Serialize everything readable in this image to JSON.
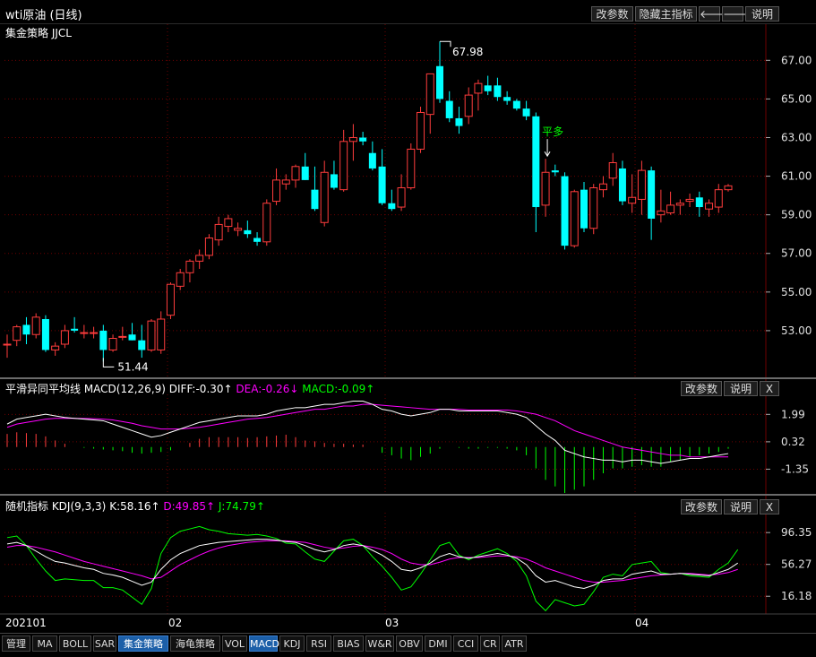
{
  "window": {
    "title": "wti原油 (日线)",
    "indicator_name": "集金策略 JJCL"
  },
  "main_buttons": {
    "params": "改参数",
    "hide": "隐藏主指标",
    "left": "🡐",
    "right": "🡒",
    "help": "说明"
  },
  "macd_panel": {
    "name": "平滑异同平均线 MACD(12,26,9)",
    "diff": "DIFF:-0.30↑",
    "dea": "DEA:-0.26↓",
    "macd": "MACD:-0.09↑",
    "params": "改参数",
    "help": "说明",
    "close": "X"
  },
  "kdj_panel": {
    "name": "随机指标 KDJ(9,3,3)",
    "k": "K:58.16↑",
    "d": "D:49.85↑",
    "j": "J:74.79↑",
    "params": "改参数",
    "help": "说明",
    "close": "X"
  },
  "x_axis": {
    "labels": [
      "202101",
      "02",
      "03",
      "04"
    ]
  },
  "annotations": {
    "high": "67.98",
    "low": "51.44",
    "signal": "平多"
  },
  "tabs": [
    "管理",
    "MA",
    "BOLL",
    "SAR",
    "集金策略",
    "海龟策略",
    "VOL",
    "MACD",
    "KDJ",
    "RSI",
    "BIAS",
    "W&R",
    "OBV",
    "DMI",
    "CCI",
    "CR",
    "ATR"
  ],
  "active_tabs": [
    "集金策略",
    "MACD"
  ],
  "colors": {
    "up": "#ff3c3c",
    "down": "#00ffff",
    "dea": "#ff00ff",
    "green": "#00ff00",
    "grid": "#6e0000"
  },
  "chart_data": [
    {
      "type": "candlestick",
      "title": "wti原油 (日线)",
      "y_ticks": [
        53.0,
        55.0,
        57.0,
        59.0,
        61.0,
        63.0,
        65.0,
        67.0
      ],
      "ylim": [
        51.0,
        68.5
      ],
      "high_label": 67.98,
      "low_label": 51.44,
      "ohlc": [
        [
          52.3,
          52.8,
          51.6,
          52.3
        ],
        [
          52.5,
          53.3,
          52.2,
          53.2
        ],
        [
          53.3,
          53.7,
          52.3,
          52.8
        ],
        [
          52.8,
          53.9,
          52.6,
          53.7
        ],
        [
          53.6,
          53.8,
          51.9,
          52.0
        ],
        [
          52.0,
          52.4,
          51.7,
          52.2
        ],
        [
          52.3,
          53.3,
          52.1,
          53.0
        ],
        [
          53.1,
          53.7,
          52.9,
          53.0
        ],
        [
          52.9,
          53.3,
          52.6,
          52.9
        ],
        [
          52.9,
          53.2,
          52.6,
          52.9
        ],
        [
          53.0,
          53.3,
          51.4,
          52.0
        ],
        [
          52.0,
          52.8,
          51.9,
          52.6
        ],
        [
          52.7,
          53.2,
          52.5,
          52.7
        ],
        [
          52.8,
          53.4,
          52.5,
          52.5
        ],
        [
          52.5,
          53.3,
          51.6,
          52.0
        ],
        [
          52.0,
          53.6,
          51.9,
          53.5
        ],
        [
          52.0,
          54.0,
          51.8,
          53.6
        ],
        [
          53.8,
          55.5,
          53.6,
          55.4
        ],
        [
          55.3,
          56.2,
          55.1,
          56.0
        ],
        [
          56.0,
          56.7,
          55.5,
          56.6
        ],
        [
          56.6,
          57.2,
          56.2,
          56.9
        ],
        [
          56.9,
          58.0,
          56.7,
          57.8
        ],
        [
          57.7,
          58.9,
          57.4,
          58.5
        ],
        [
          58.4,
          59.0,
          58.1,
          58.8
        ],
        [
          58.2,
          58.6,
          57.9,
          58.3
        ],
        [
          58.2,
          58.7,
          57.8,
          58.0
        ],
        [
          57.8,
          58.1,
          57.4,
          57.6
        ],
        [
          57.6,
          59.8,
          57.4,
          59.6
        ],
        [
          59.7,
          61.4,
          59.5,
          60.8
        ],
        [
          60.6,
          61.1,
          60.3,
          60.8
        ],
        [
          60.8,
          61.6,
          60.4,
          61.5
        ],
        [
          61.5,
          62.2,
          60.8,
          60.8
        ],
        [
          60.3,
          61.5,
          59.2,
          59.3
        ],
        [
          58.6,
          61.8,
          58.4,
          61.2
        ],
        [
          61.1,
          61.8,
          60.3,
          60.4
        ],
        [
          60.3,
          63.4,
          60.2,
          62.8
        ],
        [
          62.8,
          63.7,
          61.8,
          63.0
        ],
        [
          63.0,
          63.3,
          62.6,
          62.8
        ],
        [
          62.2,
          62.8,
          61.3,
          61.4
        ],
        [
          61.5,
          62.4,
          59.5,
          59.6
        ],
        [
          59.6,
          60.3,
          59.2,
          59.3
        ],
        [
          59.4,
          61.1,
          59.2,
          60.4
        ],
        [
          60.4,
          62.7,
          60.3,
          62.4
        ],
        [
          62.4,
          64.6,
          62.2,
          64.3
        ],
        [
          64.2,
          66.3,
          63.2,
          66.3
        ],
        [
          66.7,
          67.98,
          64.8,
          65.0
        ],
        [
          64.9,
          65.4,
          63.8,
          64.0
        ],
        [
          64.0,
          64.6,
          63.2,
          63.6
        ],
        [
          64.1,
          65.6,
          63.7,
          65.2
        ],
        [
          65.3,
          66.0,
          64.4,
          65.8
        ],
        [
          65.7,
          66.2,
          65.2,
          65.4
        ],
        [
          65.7,
          66.1,
          64.9,
          65.1
        ],
        [
          65.1,
          65.4,
          64.7,
          64.9
        ],
        [
          64.9,
          65.0,
          64.4,
          64.5
        ],
        [
          64.5,
          64.9,
          63.9,
          64.1
        ],
        [
          64.1,
          64.3,
          58.1,
          59.4
        ],
        [
          59.5,
          61.9,
          58.9,
          61.2
        ],
        [
          61.3,
          61.6,
          61.0,
          61.2
        ],
        [
          61.0,
          61.2,
          57.2,
          57.4
        ],
        [
          57.4,
          60.3,
          57.3,
          60.2
        ],
        [
          60.3,
          60.7,
          58.1,
          58.3
        ],
        [
          58.3,
          60.6,
          58.0,
          60.4
        ],
        [
          60.3,
          61.0,
          59.9,
          60.6
        ],
        [
          60.9,
          62.2,
          60.5,
          61.7
        ],
        [
          61.4,
          61.8,
          59.5,
          59.7
        ],
        [
          59.6,
          61.1,
          59.1,
          59.9
        ],
        [
          59.8,
          61.8,
          59.0,
          61.3
        ],
        [
          61.3,
          61.5,
          57.7,
          58.8
        ],
        [
          59.0,
          60.3,
          58.6,
          59.2
        ],
        [
          59.1,
          60.2,
          59.0,
          59.5
        ],
        [
          59.5,
          59.8,
          59.0,
          59.6
        ],
        [
          59.7,
          60.1,
          59.4,
          59.8
        ],
        [
          59.9,
          60.2,
          58.9,
          59.4
        ],
        [
          59.3,
          59.8,
          58.9,
          59.6
        ],
        [
          59.4,
          60.6,
          59.1,
          60.3
        ],
        [
          60.3,
          60.6,
          60.2,
          60.5
        ]
      ]
    },
    {
      "type": "line",
      "title": "平滑异同平均线 MACD(12,26,9)",
      "y_ticks": [
        1.99,
        0.32,
        -1.35
      ],
      "ylim": [
        -2.8,
        3.1
      ],
      "series": [
        {
          "name": "DIFF",
          "values": [
            1.4,
            1.7,
            1.8,
            1.9,
            2.0,
            1.9,
            1.8,
            1.75,
            1.7,
            1.65,
            1.6,
            1.4,
            1.2,
            1.0,
            0.8,
            0.6,
            0.7,
            0.9,
            1.1,
            1.3,
            1.5,
            1.6,
            1.7,
            1.8,
            1.9,
            1.9,
            1.9,
            2.0,
            2.2,
            2.3,
            2.4,
            2.4,
            2.5,
            2.6,
            2.6,
            2.7,
            2.8,
            2.8,
            2.6,
            2.3,
            2.2,
            2.0,
            1.9,
            2.0,
            2.1,
            2.3,
            2.3,
            2.2,
            2.2,
            2.2,
            2.2,
            2.2,
            2.1,
            2.0,
            1.8,
            1.3,
            0.8,
            0.4,
            -0.2,
            -0.4,
            -0.6,
            -0.7,
            -0.8,
            -0.8,
            -0.9,
            -0.8,
            -0.8,
            -0.9,
            -1.0,
            -0.9,
            -0.8,
            -0.7,
            -0.7,
            -0.6,
            -0.5,
            -0.4
          ]
        },
        {
          "name": "DEA",
          "values": [
            1.2,
            1.4,
            1.5,
            1.6,
            1.7,
            1.75,
            1.75,
            1.75,
            1.74,
            1.73,
            1.7,
            1.65,
            1.55,
            1.45,
            1.3,
            1.2,
            1.1,
            1.1,
            1.1,
            1.15,
            1.2,
            1.3,
            1.4,
            1.5,
            1.6,
            1.7,
            1.75,
            1.8,
            1.9,
            2.0,
            2.1,
            2.2,
            2.3,
            2.3,
            2.4,
            2.5,
            2.5,
            2.6,
            2.6,
            2.55,
            2.5,
            2.45,
            2.4,
            2.35,
            2.3,
            2.3,
            2.3,
            2.3,
            2.25,
            2.25,
            2.25,
            2.25,
            2.25,
            2.2,
            2.1,
            2.0,
            1.8,
            1.6,
            1.3,
            1.0,
            0.8,
            0.6,
            0.4,
            0.2,
            0.0,
            -0.1,
            -0.2,
            -0.3,
            -0.4,
            -0.5,
            -0.5,
            -0.6,
            -0.6,
            -0.6,
            -0.6,
            -0.6
          ]
        },
        {
          "name": "MACD",
          "values": [
            0.8,
            0.9,
            0.85,
            0.8,
            0.65,
            0.4,
            0.2,
            0.0,
            -0.05,
            -0.1,
            -0.15,
            -0.2,
            -0.25,
            -0.35,
            -0.4,
            -0.35,
            -0.3,
            -0.2,
            0.0,
            0.25,
            0.5,
            0.6,
            0.6,
            0.6,
            0.6,
            0.55,
            0.6,
            0.65,
            0.7,
            0.75,
            0.6,
            0.4,
            0.35,
            0.25,
            0.2,
            0.2,
            0.15,
            0.15,
            0.0,
            -0.35,
            -0.5,
            -0.7,
            -0.8,
            -0.6,
            -0.4,
            -0.1,
            0.0,
            -0.05,
            -0.1,
            -0.1,
            -0.05,
            -0.05,
            -0.1,
            -0.2,
            -0.5,
            -1.3,
            -2.0,
            -2.4,
            -2.8,
            -2.6,
            -2.4,
            -2.0,
            -1.6,
            -1.3,
            -1.3,
            -1.2,
            -1.1,
            -1.2,
            -1.2,
            -0.9,
            -0.8,
            -0.6,
            -0.5,
            -0.4,
            -0.3,
            -0.1
          ]
        }
      ]
    },
    {
      "type": "line",
      "title": "随机指标 KDJ(9,3,3)",
      "y_ticks": [
        96.35,
        56.27,
        16.18
      ],
      "ylim": [
        -5,
        118
      ],
      "series": [
        {
          "name": "K",
          "values": [
            82,
            84,
            80,
            73,
            66,
            60,
            58,
            55,
            52,
            50,
            45,
            43,
            40,
            35,
            30,
            34,
            50,
            62,
            70,
            75,
            80,
            82,
            84,
            85,
            86,
            87,
            88,
            88,
            87,
            85,
            84,
            80,
            75,
            72,
            75,
            80,
            82,
            80,
            74,
            68,
            60,
            50,
            48,
            52,
            58,
            66,
            70,
            66,
            64,
            66,
            68,
            70,
            68,
            64,
            56,
            42,
            34,
            36,
            32,
            28,
            26,
            30,
            36,
            38,
            38,
            44,
            46,
            48,
            44,
            44,
            45,
            44,
            43,
            42,
            46,
            50,
            58
          ]
        },
        {
          "name": "D",
          "values": [
            78,
            80,
            80,
            78,
            75,
            72,
            68,
            64,
            60,
            57,
            54,
            51,
            48,
            45,
            42,
            38,
            40,
            48,
            56,
            62,
            68,
            73,
            77,
            80,
            82,
            84,
            85,
            86,
            86,
            86,
            85,
            84,
            81,
            78,
            76,
            77,
            79,
            80,
            78,
            75,
            70,
            63,
            58,
            56,
            56,
            59,
            63,
            65,
            65,
            65,
            66,
            67,
            67,
            66,
            63,
            58,
            52,
            48,
            44,
            40,
            36,
            34,
            34,
            35,
            36,
            38,
            40,
            42,
            43,
            44,
            45,
            45,
            44,
            43,
            44,
            46,
            50
          ]
        },
        {
          "name": "J",
          "values": [
            90,
            92,
            80,
            63,
            48,
            36,
            38,
            37,
            36,
            36,
            27,
            27,
            24,
            15,
            6,
            26,
            70,
            90,
            98,
            101,
            104,
            100,
            98,
            95,
            94,
            93,
            94,
            92,
            89,
            83,
            82,
            72,
            63,
            60,
            73,
            86,
            88,
            80,
            66,
            54,
            40,
            24,
            28,
            44,
            62,
            80,
            84,
            68,
            62,
            68,
            72,
            76,
            70,
            60,
            42,
            10,
            -2,
            12,
            8,
            4,
            6,
            22,
            40,
            44,
            42,
            56,
            58,
            60,
            46,
            44,
            45,
            42,
            41,
            40,
            50,
            58,
            75
          ]
        }
      ]
    }
  ]
}
